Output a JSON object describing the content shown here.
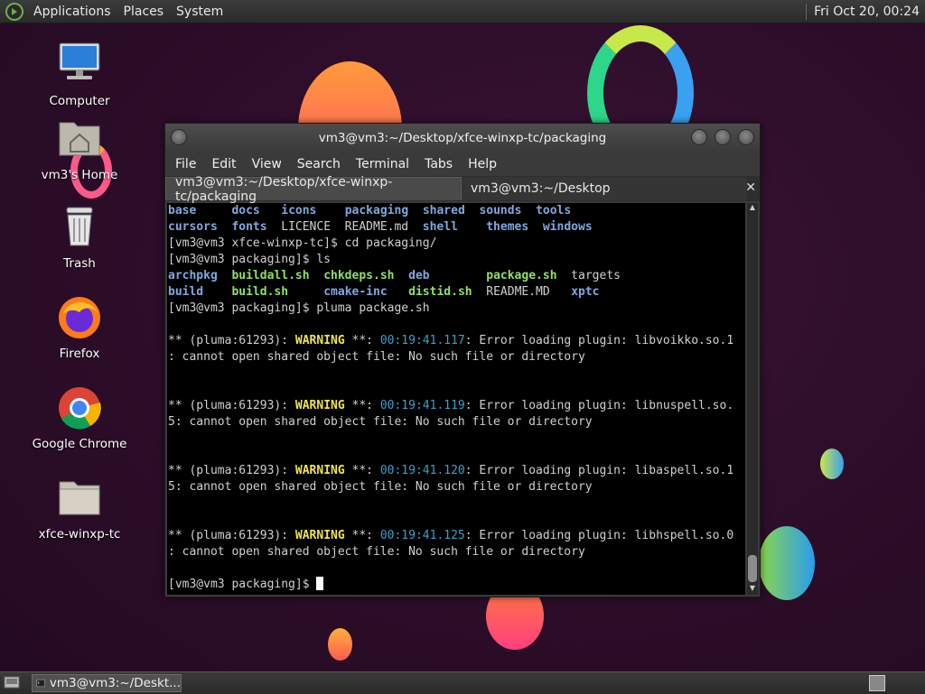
{
  "top_panel": {
    "menus": [
      "Applications",
      "Places",
      "System"
    ],
    "clock": "Fri Oct 20, 00:24"
  },
  "desktop_icons": [
    {
      "label": "Computer",
      "icon": "computer-icon"
    },
    {
      "label": "vm3's Home",
      "icon": "home-folder-icon"
    },
    {
      "label": "Trash",
      "icon": "trash-icon"
    },
    {
      "label": "Firefox",
      "icon": "firefox-icon"
    },
    {
      "label": "Google Chrome",
      "icon": "chrome-icon"
    },
    {
      "label": "xfce-winxp-tc",
      "icon": "folder-icon"
    }
  ],
  "terminal": {
    "title": "vm3@vm3:~/Desktop/xfce-winxp-tc/packaging",
    "menu": [
      "File",
      "Edit",
      "View",
      "Search",
      "Terminal",
      "Tabs",
      "Help"
    ],
    "tabs": [
      {
        "label": "vm3@vm3:~/Desktop/xfce-winxp-tc/packaging",
        "active": true
      },
      {
        "label": "vm3@vm3:~/Desktop",
        "active": false
      }
    ],
    "lines": [
      {
        "segs": [
          [
            "base",
            "dir"
          ],
          [
            "     ",
            ""
          ],
          [
            "docs",
            "dir"
          ],
          [
            "   ",
            ""
          ],
          [
            "icons",
            "dir"
          ],
          [
            "    ",
            ""
          ],
          [
            "packaging",
            "dir"
          ],
          [
            "  ",
            ""
          ],
          [
            "shared",
            "dir"
          ],
          [
            "  ",
            ""
          ],
          [
            "sounds",
            "dir"
          ],
          [
            "  ",
            ""
          ],
          [
            "tools",
            "dir"
          ]
        ]
      },
      {
        "segs": [
          [
            "cursors",
            "dir"
          ],
          [
            "  ",
            ""
          ],
          [
            "fonts",
            "dir"
          ],
          [
            "  LICENCE  README.md  ",
            ""
          ],
          [
            "shell",
            "dir"
          ],
          [
            "    ",
            ""
          ],
          [
            "themes",
            "dir"
          ],
          [
            "  ",
            ""
          ],
          [
            "windows",
            "dir"
          ]
        ]
      },
      {
        "segs": [
          [
            "[vm3@vm3 xfce-winxp-tc]$ cd packaging/",
            ""
          ]
        ]
      },
      {
        "segs": [
          [
            "[vm3@vm3 packaging]$ ls",
            ""
          ]
        ]
      },
      {
        "segs": [
          [
            "archpkg",
            "dir"
          ],
          [
            "  ",
            ""
          ],
          [
            "buildall.sh",
            "exe"
          ],
          [
            "  ",
            ""
          ],
          [
            "chkdeps.sh",
            "exe"
          ],
          [
            "  ",
            ""
          ],
          [
            "deb",
            "dir"
          ],
          [
            "        ",
            ""
          ],
          [
            "package.sh",
            "exe"
          ],
          [
            "  targets",
            ""
          ]
        ]
      },
      {
        "segs": [
          [
            "build",
            "dir"
          ],
          [
            "    ",
            ""
          ],
          [
            "build.sh",
            "exe"
          ],
          [
            "     ",
            ""
          ],
          [
            "cmake-inc",
            "dir"
          ],
          [
            "   ",
            ""
          ],
          [
            "distid.sh",
            "exe"
          ],
          [
            "  README.MD   ",
            ""
          ],
          [
            "xptc",
            "dir"
          ]
        ]
      },
      {
        "segs": [
          [
            "[vm3@vm3 packaging]$ pluma package.sh",
            ""
          ]
        ]
      },
      {
        "segs": []
      },
      {
        "segs": [
          [
            "** (pluma:61293): ",
            ""
          ],
          [
            "WARNING",
            "warn"
          ],
          [
            " **: ",
            ""
          ],
          [
            "00:19:41.117",
            "time"
          ],
          [
            ": Error loading plugin: libvoikko.so.1",
            ""
          ]
        ]
      },
      {
        "segs": [
          [
            ": cannot open shared object file: No such file or directory",
            ""
          ]
        ]
      },
      {
        "segs": []
      },
      {
        "segs": []
      },
      {
        "segs": [
          [
            "** (pluma:61293): ",
            ""
          ],
          [
            "WARNING",
            "warn"
          ],
          [
            " **: ",
            ""
          ],
          [
            "00:19:41.119",
            "time"
          ],
          [
            ": Error loading plugin: libnuspell.so.",
            ""
          ]
        ]
      },
      {
        "segs": [
          [
            "5: cannot open shared object file: No such file or directory",
            ""
          ]
        ]
      },
      {
        "segs": []
      },
      {
        "segs": []
      },
      {
        "segs": [
          [
            "** (pluma:61293): ",
            ""
          ],
          [
            "WARNING",
            "warn"
          ],
          [
            " **: ",
            ""
          ],
          [
            "00:19:41.120",
            "time"
          ],
          [
            ": Error loading plugin: libaspell.so.1",
            ""
          ]
        ]
      },
      {
        "segs": [
          [
            "5: cannot open shared object file: No such file or directory",
            ""
          ]
        ]
      },
      {
        "segs": []
      },
      {
        "segs": []
      },
      {
        "segs": [
          [
            "** (pluma:61293): ",
            ""
          ],
          [
            "WARNING",
            "warn"
          ],
          [
            " **: ",
            ""
          ],
          [
            "00:19:41.125",
            "time"
          ],
          [
            ": Error loading plugin: libhspell.so.0",
            ""
          ]
        ]
      },
      {
        "segs": [
          [
            ": cannot open shared object file: No such file or directory",
            ""
          ]
        ]
      },
      {
        "segs": []
      },
      {
        "segs": [
          [
            "[vm3@vm3 packaging]$ ",
            ""
          ]
        ],
        "cursor": true
      }
    ]
  },
  "taskbar": {
    "task_label": "vm3@vm3:~/Deskt..."
  },
  "colors": {
    "dir": "#7fa8e0",
    "exe": "#8ee06a",
    "warn": "#f2e44a",
    "time": "#3aa0c8"
  }
}
